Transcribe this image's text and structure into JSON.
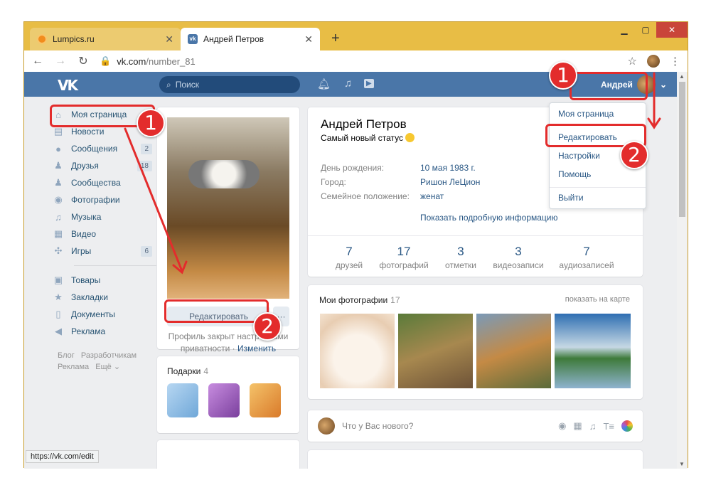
{
  "browser": {
    "tabs": [
      {
        "title": "Lumpics.ru",
        "favicon": "lumpics-favicon"
      },
      {
        "title": "Андрей Петров",
        "favicon": "vk-favicon"
      }
    ],
    "new_tab": "+",
    "url_domain": "vk.com",
    "url_path": "/number_81",
    "status_url": "https://vk.com/edit"
  },
  "vk_header": {
    "logo": "VK",
    "search_placeholder": "Поиск",
    "user_name": "Андрей"
  },
  "left_nav": {
    "items": [
      {
        "label": "Моя страница",
        "icon": "home-icon",
        "badge": ""
      },
      {
        "label": "Новости",
        "icon": "news-icon",
        "badge": ""
      },
      {
        "label": "Сообщения",
        "icon": "messages-icon",
        "badge": "2"
      },
      {
        "label": "Друзья",
        "icon": "friends-icon",
        "badge": "18"
      },
      {
        "label": "Сообщества",
        "icon": "groups-icon",
        "badge": ""
      },
      {
        "label": "Фотографии",
        "icon": "camera-icon",
        "badge": ""
      },
      {
        "label": "Музыка",
        "icon": "music-icon",
        "badge": ""
      },
      {
        "label": "Видео",
        "icon": "video-icon",
        "badge": ""
      },
      {
        "label": "Игры",
        "icon": "games-icon",
        "badge": "6"
      }
    ],
    "items2": [
      {
        "label": "Товары",
        "icon": "shopping-bag-icon"
      },
      {
        "label": "Закладки",
        "icon": "star-icon"
      },
      {
        "label": "Документы",
        "icon": "document-icon"
      },
      {
        "label": "Реклама",
        "icon": "megaphone-icon"
      }
    ],
    "footer_line1": "Блог   Разработчикам",
    "footer_line2": "Реклама   Ещё ⌄"
  },
  "profile": {
    "edit_button": "Редактировать",
    "more_button": "···",
    "privacy_text": "Профиль закрыт настройками приватности · ",
    "privacy_link": "Изменить",
    "gifts_title": "Подарки",
    "gifts_count": "4",
    "name": "Андрей Петров",
    "status": "Самый новый статус",
    "info": [
      {
        "key": "День рождения:",
        "value": "10 мая 1983 г."
      },
      {
        "key": "Город:",
        "value": "Ришон ЛеЦион"
      },
      {
        "key": "Семейное положение:",
        "value": "женат"
      }
    ],
    "show_more": "Показать подробную информацию",
    "counters": [
      {
        "n": "7",
        "label": "друзей"
      },
      {
        "n": "17",
        "label": "фотографий"
      },
      {
        "n": "3",
        "label": "отметки"
      },
      {
        "n": "3",
        "label": "видеозаписи"
      },
      {
        "n": "7",
        "label": "аудиозаписей"
      }
    ],
    "photos_title": "Мои фотографии",
    "photos_count": "17",
    "photos_map_link": "показать на карте",
    "composer_placeholder": "Что у Вас нового?"
  },
  "user_menu": {
    "items": [
      "Моя страница",
      "Редактировать",
      "Настройки",
      "Помощь",
      "Выйти"
    ]
  },
  "annotations": {
    "step1": "1",
    "step2": "2",
    "color": "#e32c2c"
  }
}
